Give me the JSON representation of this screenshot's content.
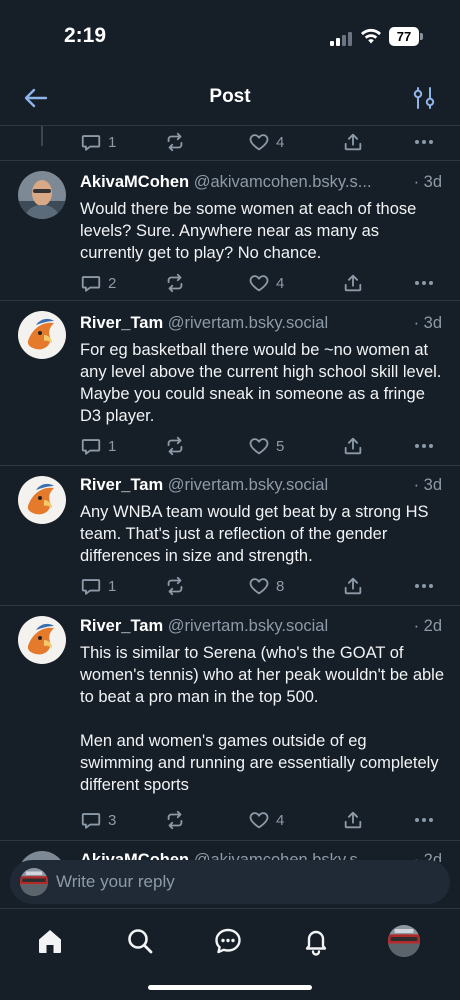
{
  "status_bar": {
    "time": "2:19",
    "battery": "77"
  },
  "header": {
    "title": "Post"
  },
  "parent_actions": {
    "replies": "1",
    "likes": "4"
  },
  "posts": [
    {
      "name": "AkivaMCohen",
      "handle": "@akivamcohen.bsky.s...",
      "time": "· 3d",
      "text": "Would there be some women at each of those levels? Sure. Anywhere near as many as currently get to play? No chance.",
      "replies": "2",
      "likes": "4"
    },
    {
      "name": "River_Tam",
      "handle": "@rivertam.bsky.social",
      "time": "· 3d",
      "text": "For eg basketball there would be ~no women at any level above the current high school skill level. Maybe you could sneak in someone as a fringe D3 player.",
      "replies": "1",
      "likes": "5"
    },
    {
      "name": "River_Tam",
      "handle": "@rivertam.bsky.social",
      "time": "· 3d",
      "text": "Any WNBA team would get beat by a strong HS team. That's just a reflection of the gender differences in size and strength.",
      "replies": "1",
      "likes": "8"
    },
    {
      "name": "River_Tam",
      "handle": "@rivertam.bsky.social",
      "time": "· 2d",
      "text": "This is similar to Serena (who's the GOAT of women's tennis) who at her peak wouldn't be able to beat a pro man in the top 500.\n\nMen and women's games outside of eg swimming and running are essentially completely different sports",
      "replies": "3",
      "likes": "4"
    }
  ],
  "next_post": {
    "name": "AkivaMCohen",
    "handle": "@akivamcohen.bsky.s...",
    "time": "· 2d"
  },
  "reply": {
    "placeholder": "Write your reply"
  },
  "tabs": [
    "home",
    "search",
    "chat",
    "notifications",
    "profile"
  ],
  "colors": {
    "background": "#161e27",
    "muted": "#8d9aa8",
    "divider": "#2c3744"
  },
  "icons": [
    "back-arrow-icon",
    "sliders-icon",
    "reply-icon",
    "repost-icon",
    "heart-icon",
    "share-icon",
    "more-icon",
    "home-icon",
    "search-icon",
    "chat-icon",
    "bell-icon"
  ]
}
